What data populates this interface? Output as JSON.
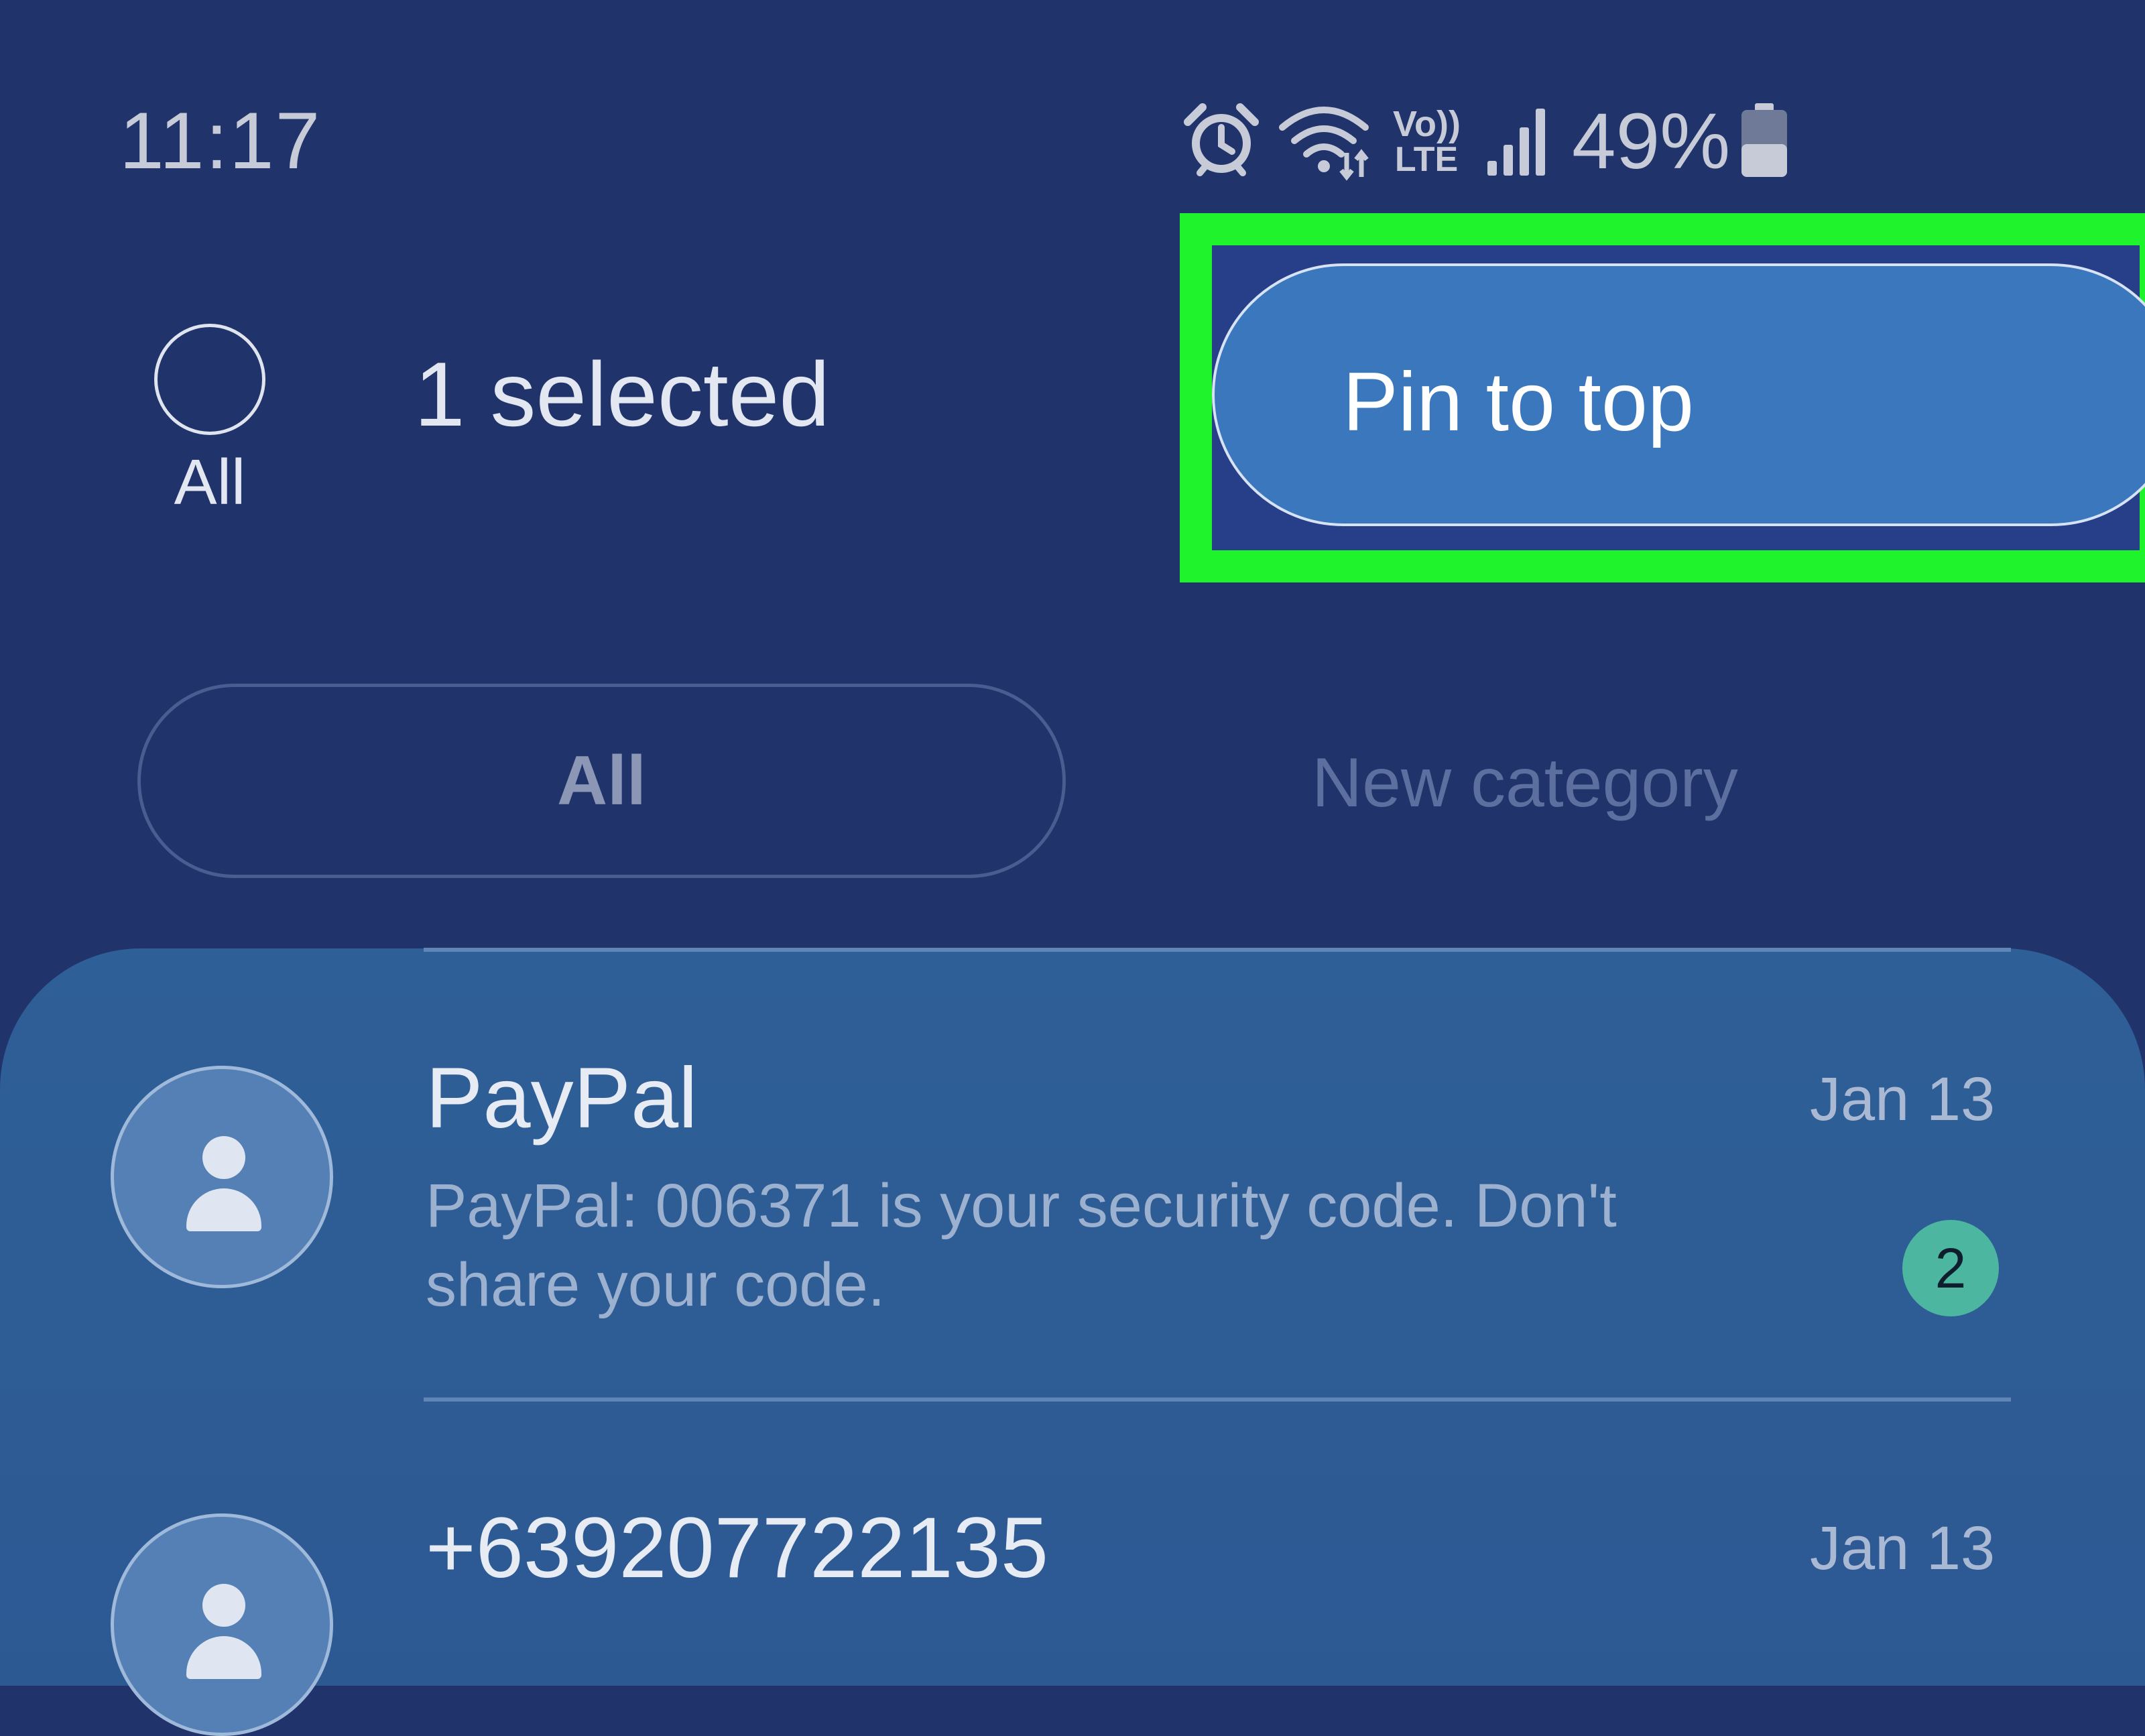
{
  "status_bar": {
    "time": "11:17",
    "icons": [
      "alarm-icon",
      "wifi-icon",
      "volte-icon",
      "signal-icon",
      "battery-icon"
    ],
    "volte_text_top": "Vo))",
    "volte_text_bottom": "LTE",
    "battery_percent": "49%",
    "battery_level": 0.49
  },
  "header": {
    "select_all_label": "All",
    "selected_count_label": "1 selected",
    "pin_button_label": "Pin to top"
  },
  "tabs": {
    "all_label": "All",
    "new_category_label": "New category"
  },
  "conversations": [
    {
      "sender": "PayPal",
      "date": "Jan 13",
      "preview": "PayPal: 006371 is your security code. Don't share your code.",
      "unread_count": "2"
    },
    {
      "sender": "+639207722135",
      "date": "Jan 13"
    }
  ],
  "colors": {
    "background": "#20346b",
    "highlight": "#1ff32c",
    "pin_button": "#3b77bd",
    "list_panel": "#2f5f97",
    "badge": "#4cb6a1"
  }
}
